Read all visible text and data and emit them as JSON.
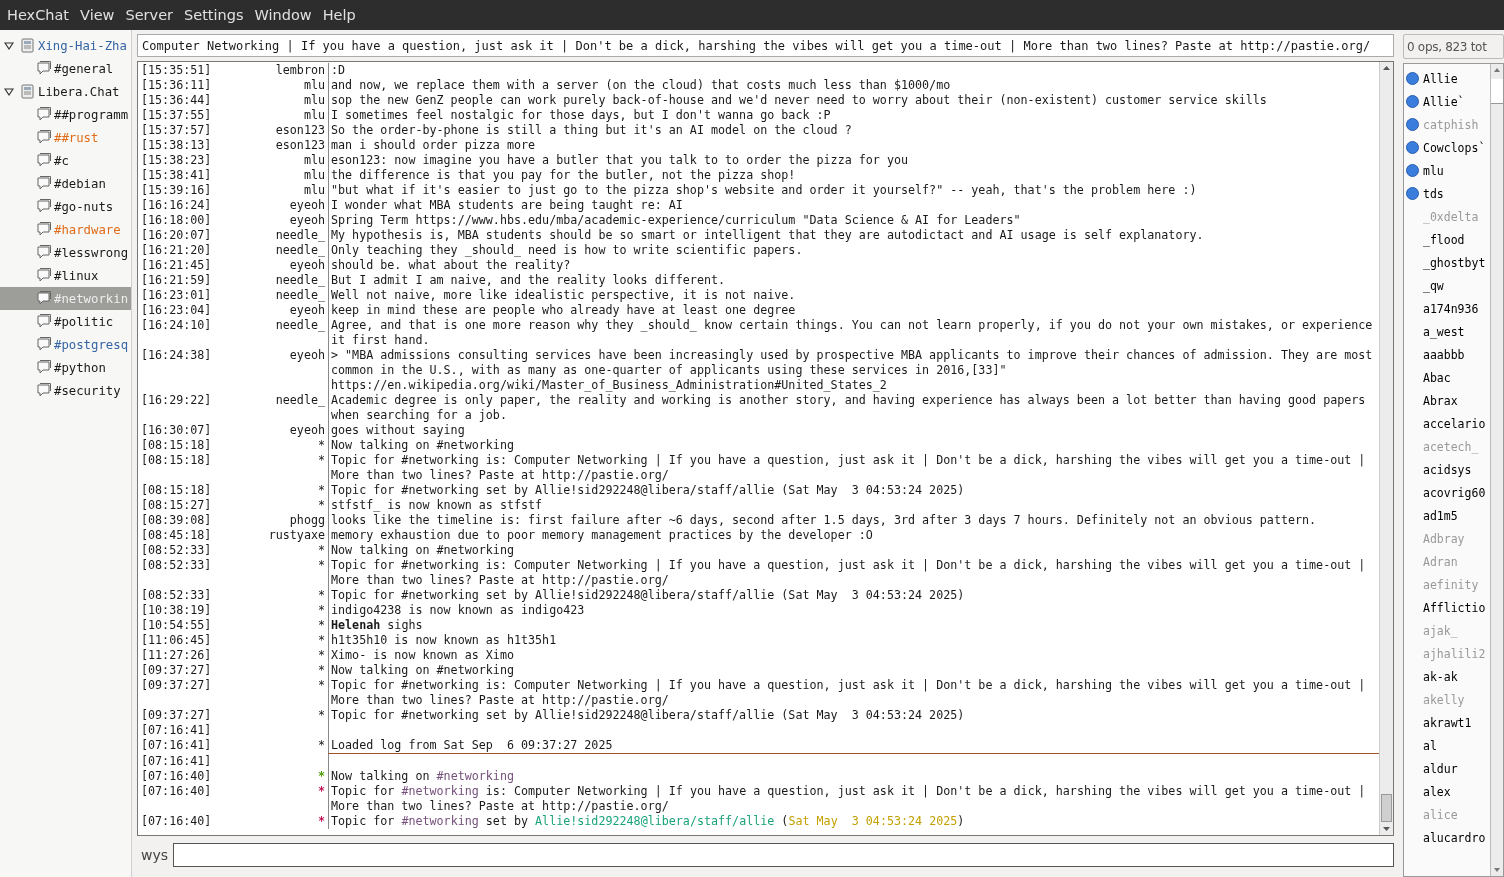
{
  "menu": [
    "HexChat",
    "View",
    "Server",
    "Settings",
    "Window",
    "Help"
  ],
  "servers": [
    {
      "name": "Xing-Hai-Zha",
      "expanded": true,
      "selected": false,
      "color": "#3465a4",
      "children": [
        {
          "name": "#general",
          "selected": false,
          "color": "#1a1a1a"
        }
      ]
    },
    {
      "name": "Libera.Chat",
      "expanded": true,
      "selected": false,
      "color": "#1a1a1a",
      "children": [
        {
          "name": "##programm",
          "selected": false,
          "color": "#1a1a1a"
        },
        {
          "name": "##rust",
          "selected": false,
          "color": "#e06c1a"
        },
        {
          "name": "#c",
          "selected": false,
          "color": "#1a1a1a"
        },
        {
          "name": "#debian",
          "selected": false,
          "color": "#1a1a1a"
        },
        {
          "name": "#go-nuts",
          "selected": false,
          "color": "#1a1a1a"
        },
        {
          "name": "#hardware",
          "selected": false,
          "color": "#e06c1a"
        },
        {
          "name": "#lesswrong",
          "selected": false,
          "color": "#1a1a1a"
        },
        {
          "name": "#linux",
          "selected": false,
          "color": "#1a1a1a"
        },
        {
          "name": "#networkin",
          "selected": true,
          "color": "#eeeeee"
        },
        {
          "name": "#politic",
          "selected": false,
          "color": "#1a1a1a"
        },
        {
          "name": "#postgresq",
          "selected": false,
          "color": "#3465a4"
        },
        {
          "name": "#python",
          "selected": false,
          "color": "#1a1a1a"
        },
        {
          "name": "#security",
          "selected": false,
          "color": "#1a1a1a"
        }
      ]
    }
  ],
  "topic": "Computer Networking | If you have a question, just ask it | Don't be a dick, harshing the vibes will get you a time-out | More than two lines? Paste at http://pastie.org/",
  "messages": [
    {
      "kind": "message",
      "time": "[15:35:51]",
      "nick": "lembron",
      "text": ":D"
    },
    {
      "kind": "message",
      "time": "[15:36:11]",
      "nick": "mlu",
      "text": "and now, we replace them with a server (on the cloud) that costs much less than $1000/mo"
    },
    {
      "kind": "message",
      "time": "[15:36:44]",
      "nick": "mlu",
      "text": "sop the new GenZ people can work purely back-of-house and we'd never need to worry about their (non-existent) customer service skills"
    },
    {
      "kind": "message",
      "time": "[15:37:55]",
      "nick": "mlu",
      "text": "I sometimes feel nostalgic for those days, but I don't wanna go back :P"
    },
    {
      "kind": "message",
      "time": "[15:37:57]",
      "nick": "eson123",
      "text": "So the order-by-phone is still a thing but it's an AI model on the cloud ?"
    },
    {
      "kind": "message",
      "time": "[15:38:13]",
      "nick": "eson123",
      "text": "man i should order pizza more"
    },
    {
      "kind": "message",
      "time": "[15:38:23]",
      "nick": "mlu",
      "text": "eson123: now imagine you have a butler that you talk to to order the pizza for you"
    },
    {
      "kind": "message",
      "time": "[15:38:41]",
      "nick": "mlu",
      "text": "the difference is that you pay for the butler, not the pizza shop!"
    },
    {
      "kind": "message",
      "time": "[15:39:16]",
      "nick": "mlu",
      "text": "\"but what if it's easier to just go to the pizza shop's website and order it yourself?\" -- yeah, that's the problem here :)"
    },
    {
      "kind": "message",
      "time": "[16:16:24]",
      "nick": "eyeoh",
      "text": "I wonder what MBA students are being taught re: AI"
    },
    {
      "kind": "message",
      "time": "[16:18:00]",
      "nick": "eyeoh",
      "text": "Spring Term https://www.hbs.edu/mba/academic-experience/curriculum \"Data Science & AI for Leaders\""
    },
    {
      "kind": "message",
      "time": "[16:20:07]",
      "nick": "needle_",
      "text": "My hypothesis is, MBA students should be so smart or intelligent that they are autodictact and AI usage is self explanatory."
    },
    {
      "kind": "message",
      "time": "[16:21:20]",
      "nick": "needle_",
      "text": "Only teaching they _should_ need is how to write scientific papers."
    },
    {
      "kind": "message",
      "time": "[16:21:45]",
      "nick": "eyeoh",
      "text": "should be. what about the reality?"
    },
    {
      "kind": "message",
      "time": "[16:21:59]",
      "nick": "needle_",
      "text": "But I admit I am naive, and the reality looks different."
    },
    {
      "kind": "message",
      "time": "[16:23:01]",
      "nick": "needle_",
      "text": "Well not naive, more like idealistic perspective, it is not naive."
    },
    {
      "kind": "message",
      "time": "[16:23:04]",
      "nick": "eyeoh",
      "text": "keep in mind these are people who already have at least one degree"
    },
    {
      "kind": "message",
      "time": "[16:24:10]",
      "nick": "needle_",
      "text": "Agree, and that is one more reason why they _should_ know certain things. You can not learn properly, if you do not your own mistakes, or experience it first hand."
    },
    {
      "kind": "message",
      "time": "[16:24:38]",
      "nick": "eyeoh",
      "text": "> \"MBA admissions consulting services have been increasingly used by prospective MBA applicants to improve their chances of admission. They are most common in the U.S., with as many as one-quarter of applicants using these services in 2016,[33]\" https://en.wikipedia.org/wiki/Master_of_Business_Administration#United_States_2"
    },
    {
      "kind": "message",
      "time": "[16:29:22]",
      "nick": "needle_",
      "text": "Academic degree is only paper, the reality and working is another story, and having experience has always been a lot better than having good papers when searching for a job."
    },
    {
      "kind": "message",
      "time": "[16:30:07]",
      "nick": "eyeoh",
      "text": "goes without saying"
    },
    {
      "kind": "message",
      "time": "[08:15:18]",
      "nick": "*",
      "text": "Now talking on #networking"
    },
    {
      "kind": "message",
      "time": "[08:15:18]",
      "nick": "*",
      "text": "Topic for #networking is: Computer Networking | If you have a question, just ask it | Don't be a dick, harshing the vibes will get you a time-out | More than two lines? Paste at http://pastie.org/"
    },
    {
      "kind": "message",
      "time": "[08:15:18]",
      "nick": "*",
      "text": "Topic for #networking set by Allie!sid292248@libera/staff/allie (Sat May  3 04:53:24 2025)"
    },
    {
      "kind": "message",
      "time": "[08:15:27]",
      "nick": "*",
      "text": "stfstf_ is now known as stfstf"
    },
    {
      "kind": "message",
      "time": "[08:39:08]",
      "nick": "phogg",
      "text": "looks like the timeline is: first failure after ~6 days, second after 1.5 days, 3rd after 3 days 7 hours. Definitely not an obvious pattern."
    },
    {
      "kind": "message",
      "time": "[08:45:18]",
      "nick": "rustyaxe",
      "text": "memory exhaustion due to poor memory management practices by the developer :O"
    },
    {
      "kind": "message",
      "time": "[08:52:33]",
      "nick": "*",
      "text": "Now talking on #networking"
    },
    {
      "kind": "message",
      "time": "[08:52:33]",
      "nick": "*",
      "text": "Topic for #networking is: Computer Networking | If you have a question, just ask it | Don't be a dick, harshing the vibes will get you a time-out | More than two lines? Paste at http://pastie.org/"
    },
    {
      "kind": "message",
      "time": "[08:52:33]",
      "nick": "*",
      "text": "Topic for #networking set by Allie!sid292248@libera/staff/allie (Sat May  3 04:53:24 2025)"
    },
    {
      "kind": "message",
      "time": "[10:38:19]",
      "nick": "*",
      "text": "indigo4238 is now known as indigo423"
    },
    {
      "kind": "message",
      "time": "[10:54:55]",
      "nick": "*",
      "text": "**Helenah** sighs"
    },
    {
      "kind": "message",
      "time": "[11:06:45]",
      "nick": "*",
      "text": "h1t35h10 is now known as h1t35h1"
    },
    {
      "kind": "message",
      "time": "[11:27:26]",
      "nick": "*",
      "text": "Ximo- is now known as Ximo"
    },
    {
      "kind": "message",
      "time": "[09:37:27]",
      "nick": "*",
      "text": "Now talking on #networking"
    },
    {
      "kind": "message",
      "time": "[09:37:27]",
      "nick": "*",
      "text": "Topic for #networking is: Computer Networking | If you have a question, just ask it | Don't be a dick, harshing the vibes will get you a time-out | More than two lines? Paste at http://pastie.org/"
    },
    {
      "kind": "message",
      "time": "[09:37:27]",
      "nick": "*",
      "text": "Topic for #networking set by Allie!sid292248@libera/staff/allie (Sat May  3 04:53:24 2025)"
    },
    {
      "kind": "message",
      "time": "[07:16:41]"
    },
    {
      "kind": "message",
      "time": "[07:16:41]",
      "nick": "*",
      "text": "Loaded log from Sat Sep  6 09:37:27 2025"
    },
    {
      "kind": "marker"
    },
    {
      "kind": "message",
      "time": "[07:16:41]"
    },
    {
      "kind": "message",
      "time": "[07:16:40]",
      "nick": "*",
      "color": "#4e9a06",
      "parts": [
        {
          "text": "Now talking on "
        },
        {
          "text": "#networking",
          "color": "#75507b"
        }
      ]
    },
    {
      "kind": "message",
      "time": "[07:16:40]",
      "nick": "*",
      "color": "#c2185b",
      "parts": [
        {
          "text": "Topic for "
        },
        {
          "text": "#networking",
          "color": "#75507b"
        },
        {
          "text": " is: Computer Networking | If you have a question, just ask it | Don't be a dick, harshing the vibes will get you a time-out | More than two lines? Paste at http://pastie.org/"
        }
      ]
    },
    {
      "kind": "message",
      "time": "[07:16:40]",
      "nick": "*",
      "color": "#c2185b",
      "parts": [
        {
          "text": "Topic for "
        },
        {
          "text": "#networking",
          "color": "#75507b"
        },
        {
          "text": " set by "
        },
        {
          "text": "Allie!sid292248@libera/staff/allie",
          "color": "#1aa37a"
        },
        {
          "text": " ("
        },
        {
          "text": "Sat May  3 04:53:24 2025",
          "color": "#c4a000"
        },
        {
          "text": ")"
        }
      ]
    }
  ],
  "input": {
    "nick": "wys"
  },
  "user_count": "0 ops, 823 tot",
  "users": [
    {
      "name": "Allie",
      "voice": true,
      "away": false
    },
    {
      "name": "Allie`",
      "voice": true,
      "away": false
    },
    {
      "name": "catphish",
      "voice": true,
      "away": true
    },
    {
      "name": "Cowclops`",
      "voice": true,
      "away": false
    },
    {
      "name": "mlu",
      "voice": true,
      "away": false
    },
    {
      "name": "tds",
      "voice": true,
      "away": false
    },
    {
      "name": "_0xdelta",
      "voice": false,
      "away": true
    },
    {
      "name": "_flood",
      "voice": false,
      "away": false
    },
    {
      "name": "_ghostbyt",
      "voice": false,
      "away": false
    },
    {
      "name": "_qw",
      "voice": false,
      "away": false
    },
    {
      "name": "a174n936",
      "voice": false,
      "away": false
    },
    {
      "name": "a_west",
      "voice": false,
      "away": false
    },
    {
      "name": "aaabbb",
      "voice": false,
      "away": false
    },
    {
      "name": "Abac",
      "voice": false,
      "away": false
    },
    {
      "name": "Abrax",
      "voice": false,
      "away": false
    },
    {
      "name": "accelario",
      "voice": false,
      "away": false
    },
    {
      "name": "acetech_",
      "voice": false,
      "away": true
    },
    {
      "name": "acidsys",
      "voice": false,
      "away": false
    },
    {
      "name": "acovrig60",
      "voice": false,
      "away": false
    },
    {
      "name": "ad1m5",
      "voice": false,
      "away": false
    },
    {
      "name": "Adbray",
      "voice": false,
      "away": true
    },
    {
      "name": "Adran",
      "voice": false,
      "away": true
    },
    {
      "name": "aefinity",
      "voice": false,
      "away": true
    },
    {
      "name": "Afflictio",
      "voice": false,
      "away": false
    },
    {
      "name": "ajak_",
      "voice": false,
      "away": true
    },
    {
      "name": "ajhalili2",
      "voice": false,
      "away": true
    },
    {
      "name": "ak-ak",
      "voice": false,
      "away": false
    },
    {
      "name": "akelly",
      "voice": false,
      "away": true
    },
    {
      "name": "akrawt1",
      "voice": false,
      "away": false
    },
    {
      "name": "al",
      "voice": false,
      "away": false
    },
    {
      "name": "aldur",
      "voice": false,
      "away": false
    },
    {
      "name": "alex",
      "voice": false,
      "away": false
    },
    {
      "name": "alice",
      "voice": false,
      "away": true
    },
    {
      "name": "alucardro",
      "voice": false,
      "away": false
    }
  ]
}
